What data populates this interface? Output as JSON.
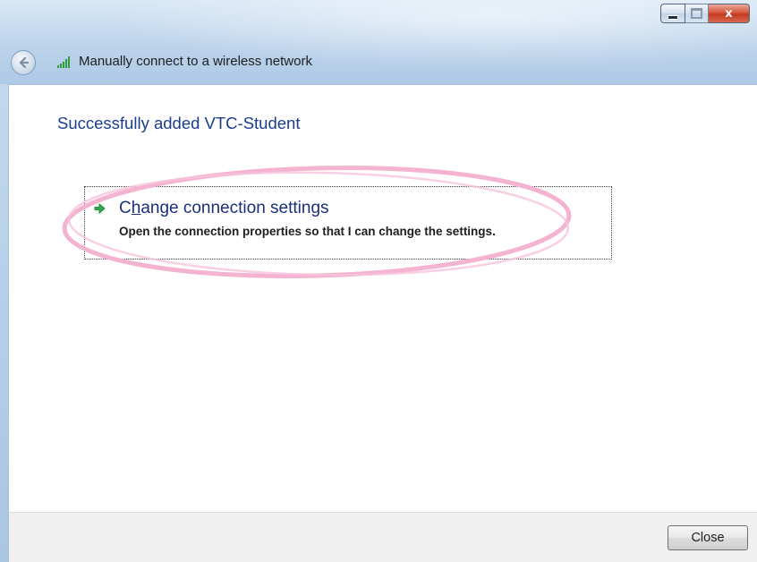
{
  "window": {
    "title": "Manually connect to a wireless network",
    "controls": {
      "minimize_icon": "minimize-icon",
      "maximize_icon": "maximize-icon",
      "close_glyph": "x"
    },
    "back_icon": "back-arrow-icon",
    "network_icon": "signal-strength-icon"
  },
  "content": {
    "heading": "Successfully added VTC-Student",
    "command_link": {
      "icon": "green-arrow-icon",
      "title_before": "C",
      "title_accel": "h",
      "title_after": "ange connection settings",
      "description": "Open the connection properties so that I can change the settings."
    },
    "annotation_color": "#f4b3d1"
  },
  "footer": {
    "close_label": "Close"
  },
  "colors": {
    "heading": "#1a3e8c",
    "link_title": "#1b2f78",
    "arrow_green": "#2fa84f"
  }
}
